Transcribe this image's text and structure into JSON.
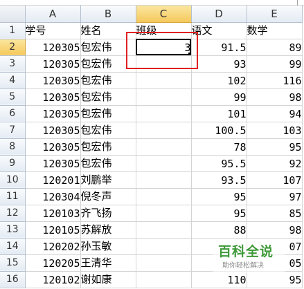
{
  "spreadsheet": {
    "columns": [
      "A",
      "B",
      "C",
      "D",
      "E"
    ],
    "selected_column": "C",
    "selected_row": "2",
    "active_cell": "C2",
    "rows": [
      {
        "row": "1",
        "A": "学号",
        "B": "姓名",
        "C": "班级",
        "D": "语文",
        "E": "数学"
      },
      {
        "row": "2",
        "A": "120305",
        "B": "包宏伟",
        "C": "3",
        "D": "91.5",
        "E": "89"
      },
      {
        "row": "3",
        "A": "120305",
        "B": "包宏伟",
        "C": "",
        "D": "93",
        "E": "99"
      },
      {
        "row": "4",
        "A": "120305",
        "B": "包宏伟",
        "C": "",
        "D": "102",
        "E": "116"
      },
      {
        "row": "5",
        "A": "120305",
        "B": "包宏伟",
        "C": "",
        "D": "99",
        "E": "98"
      },
      {
        "row": "6",
        "A": "120305",
        "B": "包宏伟",
        "C": "",
        "D": "101",
        "E": "94"
      },
      {
        "row": "7",
        "A": "120305",
        "B": "包宏伟",
        "C": "",
        "D": "100.5",
        "E": "103"
      },
      {
        "row": "8",
        "A": "120305",
        "B": "包宏伟",
        "C": "",
        "D": "78",
        "E": "95"
      },
      {
        "row": "9",
        "A": "120305",
        "B": "包宏伟",
        "C": "",
        "D": "95.5",
        "E": "92"
      },
      {
        "row": "10",
        "A": "120201",
        "B": "刘鹏举",
        "C": "",
        "D": "93.5",
        "E": "107"
      },
      {
        "row": "11",
        "A": "120304",
        "B": "倪冬声",
        "C": "",
        "D": "95",
        "E": "97"
      },
      {
        "row": "12",
        "A": "120103",
        "B": "齐飞扬",
        "C": "",
        "D": "95",
        "E": "85"
      },
      {
        "row": "13",
        "A": "120105",
        "B": "苏解放",
        "C": "",
        "D": "88",
        "E": "98"
      },
      {
        "row": "14",
        "A": "120202",
        "B": "孙玉敏",
        "C": "",
        "D": "",
        "E": "07"
      },
      {
        "row": "15",
        "A": "120205",
        "B": "王清华",
        "C": "",
        "D": "",
        "E": "05"
      },
      {
        "row": "16",
        "A": "120102",
        "B": "谢如康",
        "C": "",
        "D": "110",
        "E": "95"
      }
    ]
  },
  "watermark": {
    "main": "百科全说",
    "sub": "助你轻松解决"
  },
  "colors": {
    "highlight_box": "#e02020",
    "selected_header": "#f5c85c",
    "watermark_green": "#3f9a3a"
  }
}
